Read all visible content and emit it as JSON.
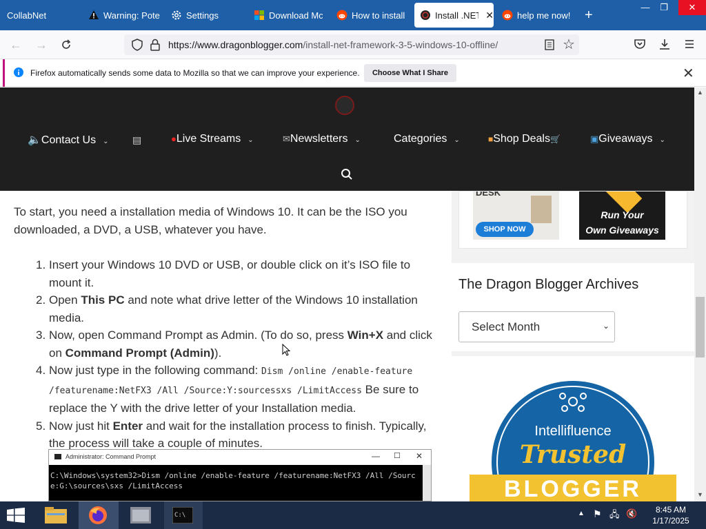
{
  "browser": {
    "tabs": [
      {
        "label": "CollabNet",
        "icon": "none"
      },
      {
        "label": "Warning: Pote",
        "icon": "warning-icon"
      },
      {
        "label": "Settings",
        "icon": "gear-icon"
      },
      {
        "label": "Download Mc",
        "icon": "microsoft-icon"
      },
      {
        "label": "How to install",
        "icon": "reddit-icon"
      },
      {
        "label": "Install .NET",
        "icon": "dragon-icon",
        "active": true
      },
      {
        "label": "help me now!",
        "icon": "reddit-icon"
      }
    ],
    "new_tab": "+",
    "url_domain": "https://www.dragonblogger.com",
    "url_path": "/install-net-framework-3-5-windows-10-offline/",
    "notification": {
      "text": "Firefox automatically sends some data to Mozilla so that we can improve your experience.",
      "button": "Choose What I Share"
    }
  },
  "site_nav": {
    "items": [
      {
        "label": "Contact Us",
        "has_menu": true
      },
      {
        "label": "Live Streams",
        "has_menu": true
      },
      {
        "label": "Newsletters",
        "has_menu": true
      },
      {
        "label": "Categories",
        "has_menu": true
      },
      {
        "label": "Shop Deals",
        "has_menu": false
      },
      {
        "label": "Giveaways",
        "has_menu": true
      }
    ]
  },
  "article": {
    "intro": "To start, you need a installation media of Windows 10. It can be the ISO you downloaded, a DVD, a USB, whatever you have.",
    "steps": [
      {
        "num": "1.",
        "parts": [
          {
            "t": "Insert your Windows 10 DVD or USB, or double click on it’s ISO file to mount it."
          }
        ]
      },
      {
        "num": "2.",
        "parts": [
          {
            "t": "Open "
          },
          {
            "t": "This PC",
            "b": true
          },
          {
            "t": " and note what drive letter of the Windows 10 installation media."
          }
        ]
      },
      {
        "num": "3.",
        "parts": [
          {
            "t": "Now, open Command Prompt as Admin. (To do so,  press "
          },
          {
            "t": "Win+X",
            "b": true
          },
          {
            "t": " and click on "
          },
          {
            "t": "Command Prompt (Admin)",
            "b": true
          },
          {
            "t": ")."
          }
        ]
      },
      {
        "num": "4.",
        "parts": [
          {
            "t": "Now just type in the following command: "
          },
          {
            "t": "Dism /online /enable-feature /featurename:NetFX3 /All /Source:Y:sourcessxs /LimitAccess",
            "m": true
          },
          {
            "t": " Be sure to replace the Y with the drive letter of your Installation media."
          }
        ]
      },
      {
        "num": "5.",
        "parts": [
          {
            "t": "Now just hit "
          },
          {
            "t": "Enter",
            "b": true
          },
          {
            "t": "  and wait for the installation process to finish. Typically, the process will take a couple of minutes."
          }
        ]
      }
    ],
    "cmd_window": {
      "title": "Administrator: Command Prompt",
      "line1": "C:\\Windows\\system32>Dism /online /enable-feature /featurename:NetFX3 /All /Sourc",
      "line2": "e:G:\\sources\\sxs /LimitAccess"
    }
  },
  "sidebar": {
    "ad_left": {
      "label": "DESK",
      "button": "SHOP NOW"
    },
    "ad_right": {
      "line1": "Run Your",
      "line2": "Own Giveaways"
    },
    "archives_title": "The Dragon Blogger Archives",
    "archives_select": "Select Month",
    "badge": {
      "top": "Intellifluence",
      "middle": "Trusted",
      "bottom": "BLOGGER"
    }
  },
  "taskbar": {
    "time": "8:45 AM",
    "date": "1/17/2025"
  },
  "colors": {
    "tabstrip": "#1e5fa8",
    "site_nav_bg": "#1f1f1f",
    "notif_accent": "#c0147d",
    "badge_blue": "#1565a6",
    "badge_yellow": "#f2c230",
    "taskbar": "#1c2b45"
  }
}
